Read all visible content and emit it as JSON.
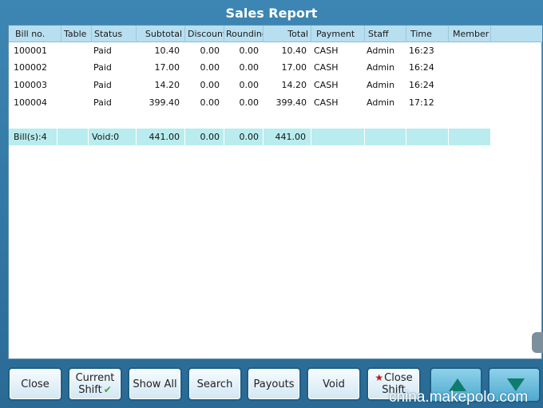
{
  "window": {
    "title": "Sales Report"
  },
  "table": {
    "headers": [
      "Bill no.",
      "Table",
      "Status",
      "Subtotal",
      "Discount",
      "Rounding",
      "Total",
      "Payment",
      "Staff",
      "Time",
      "Member"
    ],
    "rows": [
      [
        "100001",
        "",
        "Paid",
        "10.40",
        "0.00",
        "0.00",
        "10.40",
        "CASH",
        "Admin",
        "16:23",
        ""
      ],
      [
        "100002",
        "",
        "Paid",
        "17.00",
        "0.00",
        "0.00",
        "17.00",
        "CASH",
        "Admin",
        "16:24",
        ""
      ],
      [
        "100003",
        "",
        "Paid",
        "14.20",
        "0.00",
        "0.00",
        "14.20",
        "CASH",
        "Admin",
        "16:24",
        ""
      ],
      [
        "100004",
        "",
        "Paid",
        "399.40",
        "0.00",
        "0.00",
        "399.40",
        "CASH",
        "Admin",
        "17:12",
        ""
      ]
    ],
    "summary": [
      "Bill(s):4",
      "",
      "Void:0",
      "441.00",
      "0.00",
      "0.00",
      "441.00",
      "",
      "",
      "",
      ""
    ]
  },
  "buttons": {
    "close": "Close",
    "current_shift_1": "Current",
    "current_shift_2": "Shift",
    "show_all": "Show All",
    "search": "Search",
    "payouts": "Payouts",
    "void": "Void",
    "close_shift_1": "Close",
    "close_shift_2": "Shift"
  },
  "icons": {
    "current_shift": "check-icon",
    "close_shift": "star-icon",
    "scroll_up": "arrow-up-icon",
    "scroll_down": "arrow-down-icon"
  },
  "watermark": "china.makepolo.com"
}
